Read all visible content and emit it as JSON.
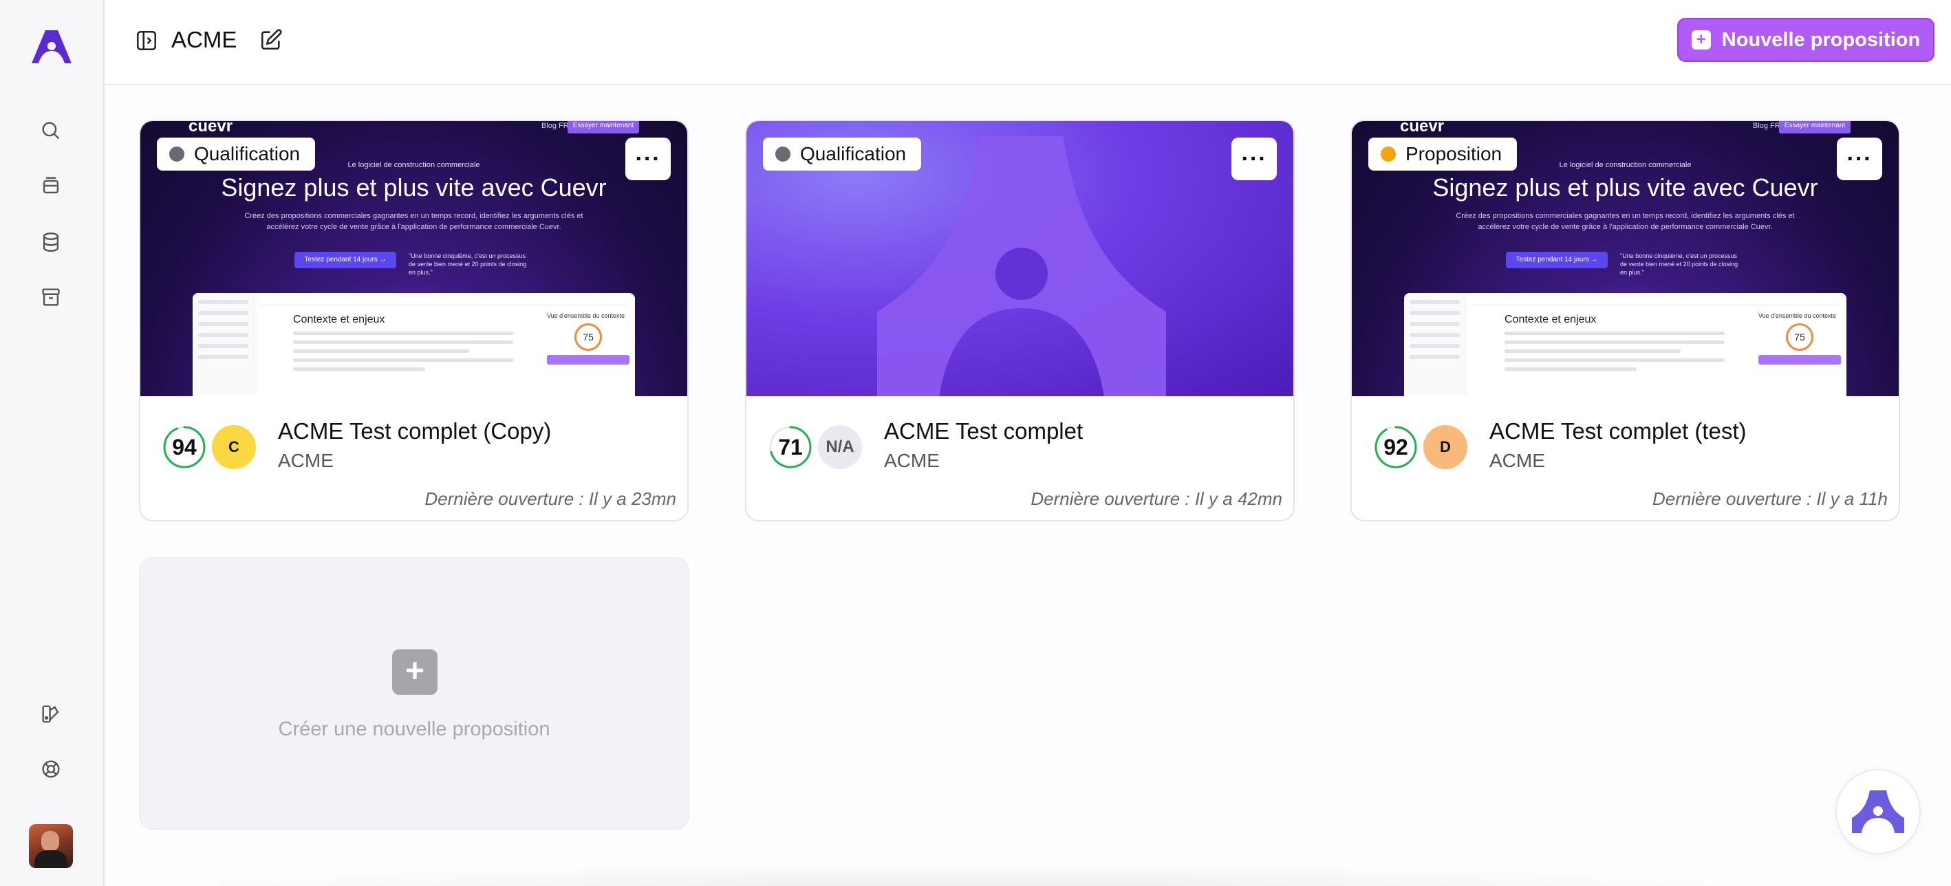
{
  "header": {
    "title": "ACME",
    "new_button_label": "Nouvelle proposition"
  },
  "sidebar": {
    "icons": [
      "brand-logo",
      "search-icon",
      "layers-icon",
      "database-icon",
      "archive-icon",
      "palette-icon",
      "lifebuoy-icon"
    ]
  },
  "cards": [
    {
      "status": "Qualification",
      "status_color": "#6b6a72",
      "score": "94",
      "score_fraction": 0.94,
      "grade": "C",
      "grade_color": "#fbd742",
      "title": "ACME Test complet (Copy)",
      "client": "ACME",
      "last_opened": "Dernière ouverture : Il y a 23mn",
      "thumbnail": "website"
    },
    {
      "status": "Qualification",
      "status_color": "#6b6a72",
      "score": "71",
      "score_fraction": 0.71,
      "grade": "N/A",
      "grade_color": "#ebe9ef",
      "title": "ACME Test complet",
      "client": "ACME",
      "last_opened": "Dernière ouverture : Il y a 42mn",
      "thumbnail": "brand"
    },
    {
      "status": "Proposition",
      "status_color": "#f5a50b",
      "score": "92",
      "score_fraction": 0.92,
      "grade": "D",
      "grade_color": "#f9b97a",
      "title": "ACME Test complet (test)",
      "client": "ACME",
      "last_opened": "Dernière ouverture : Il y a 11h",
      "thumbnail": "website"
    }
  ],
  "thumbnail_site": {
    "brand": "cuevr",
    "nav_links": "Blog    FR ⌄",
    "nav_cta": "Essayer maintenant",
    "kicker": "Le logiciel de construction commerciale",
    "headline": "Signez plus et plus vite avec Cuevr",
    "sub": "Créez des propositions commerciales gagnantes en un temps record, identifiez les arguments clés et accélérez votre cycle de vente grâce à l'application de performance commerciale Cuevr.",
    "try_button": "Testez pendant 14 jours →",
    "quote": "\"Une bonne cinquième, c'est un processus de vente bien mené et 20 points de closing en plus.\"",
    "mock_heading": "Contexte et enjeux",
    "mock_panel_title": "Vue d'ensemble du contexte",
    "mock_score": "75"
  },
  "create_card": {
    "label": "Créer une nouvelle proposition"
  },
  "colors": {
    "accent": "#b15cf7",
    "brand": "#6f3de6",
    "score_ring": "#22b14c"
  }
}
